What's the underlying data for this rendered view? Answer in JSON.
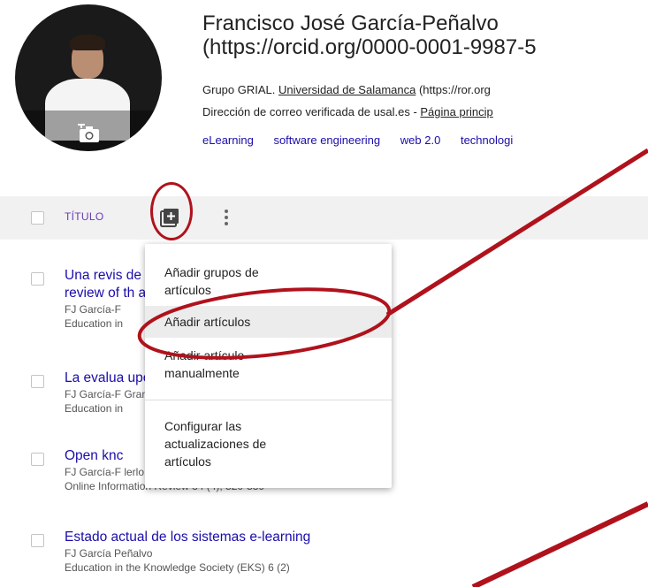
{
  "profile": {
    "name_line1": "Francisco José García-Peñalvo",
    "name_line2": "(https://orcid.org/0000-0001-9987-5",
    "affiliation_prefix": "Grupo GRIAL. ",
    "affiliation_link": "Universidad de Salamanca",
    "affiliation_suffix": " (https://ror.org",
    "email_prefix": "Dirección de correo verificada de usal.es - ",
    "email_link": "Página princip",
    "tags": [
      "eLearning",
      "software engineering",
      "web 2.0",
      "technologi"
    ]
  },
  "table_header": {
    "title_label": "TÍTULO"
  },
  "articles": [
    {
      "title_line1": "Una revis                                                      de eLearning. Décimo Aniversa",
      "title_line2": "review of                                                         th anniversary",
      "authors": "FJ García-F",
      "venue": "Education in"
    },
    {
      "title_line1": "La evalua                                                          uperior en tiempos de la COVI",
      "authors": "FJ García-F                                                                   Grande",
      "venue": "Education in"
    },
    {
      "title_line1": "Open knc",
      "authors": "FJ García-F                                                                   lerlo",
      "venue": "Online Information Review 34 (4), 520-539"
    },
    {
      "title_line1": "Estado actual de los sistemas e-learning",
      "authors": "FJ García Peñalvo",
      "venue": "Education in the Knowledge Society (EKS) 6 (2)"
    }
  ],
  "menu": {
    "items": [
      {
        "label_line1": "Añadir grupos de",
        "label_line2": "artículos"
      },
      {
        "label_line1": "Añadir artículos"
      },
      {
        "label_line1": "Añadir artículo",
        "label_line2": "manualmente"
      },
      {
        "label_line1": "Configurar las",
        "label_line2": "actualizaciones de",
        "label_line3": "artículos"
      }
    ]
  },
  "icons": {
    "add": "add-box-icon",
    "more": "more-vert-icon",
    "camera": "add-photo-icon"
  },
  "colors": {
    "link": "#1a0dab",
    "header_label": "#6a3bb3",
    "annotation_red": "#b0121c",
    "menu_highlight": "#ececec"
  }
}
